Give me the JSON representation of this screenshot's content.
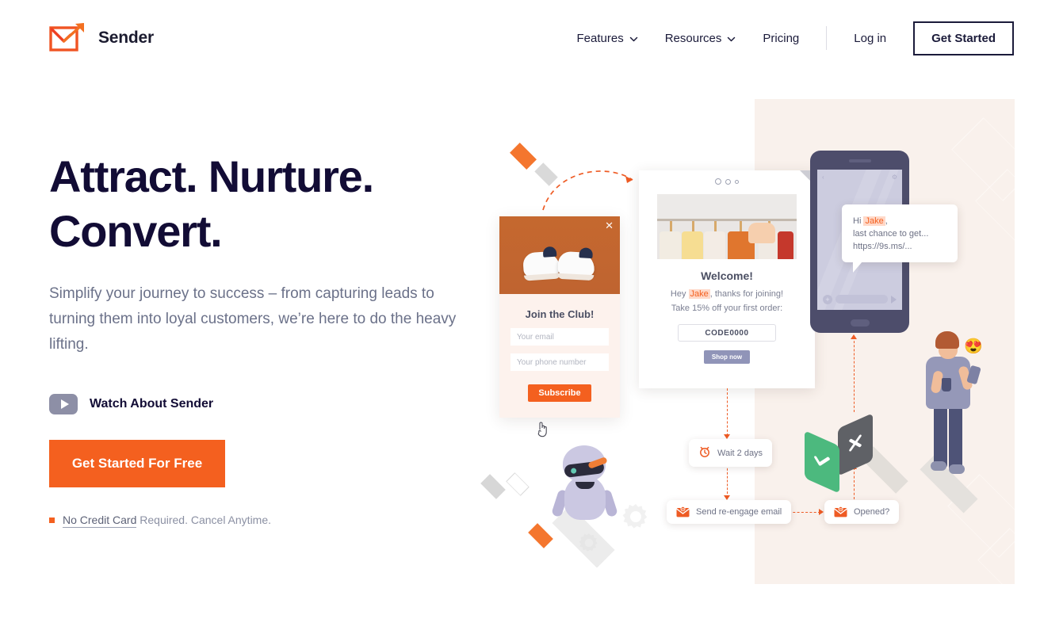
{
  "brand": {
    "name": "Sender",
    "logo_icon": "envelope-arrow-icon",
    "accent": "#f4601f",
    "dark": "#120c35"
  },
  "nav": {
    "items": [
      {
        "label": "Features",
        "has_dropdown": true,
        "icon": "chevron-down-icon"
      },
      {
        "label": "Resources",
        "has_dropdown": true,
        "icon": "chevron-down-icon"
      },
      {
        "label": "Pricing",
        "has_dropdown": false
      }
    ],
    "login_label": "Log in",
    "cta_label": "Get Started"
  },
  "hero": {
    "title_line1": "Attract. Nurture.",
    "title_line2": "Convert.",
    "subtitle": "Simplify your journey to success – from capturing leads to turning them into loyal customers, we’re here to do the heavy lifting.",
    "watch": {
      "label": "Watch About Sender",
      "icon": "play-icon"
    },
    "cta_label": "Get Started For Free",
    "note_strong": "No Credit Card",
    "note_rest": " Required. Cancel Anytime.",
    "note_bullet": "square-bullet-icon"
  },
  "illustration": {
    "popup": {
      "close_icon": "close-icon",
      "title": "Join the Club!",
      "email_placeholder": "Your email",
      "phone_placeholder": "Your phone number",
      "subscribe_label": "Subscribe",
      "image_alt": "sneakers-photo"
    },
    "email": {
      "heading": "Welcome!",
      "line1_pre": "Hey ",
      "line1_name": "Jake",
      "line1_post": ", thanks for joining!",
      "line2": "Take 15% off your first order:",
      "code": "CODE0000",
      "button_label": "Shop now",
      "image_alt": "clothing-rack-photo"
    },
    "sms": {
      "line1_pre": "Hi ",
      "line1_name": "Jake",
      "line1_post": ",",
      "line2": "last chance to get...",
      "line3": "https://9s.ms/..."
    },
    "workflow": [
      {
        "label": "Wait 2 days",
        "icon": "alarm-clock-icon"
      },
      {
        "label": "Send re-engage email",
        "icon": "envelope-icon"
      },
      {
        "label": "Opened?",
        "icon": "envelope-icon"
      }
    ],
    "decision": {
      "yes_icon": "check-icon",
      "no_icon": "x-icon"
    },
    "robot_alt": "automation-robot",
    "person_alt": "person-with-phone",
    "person_emoji": "😍",
    "cursor_icon": "pointer-hand-icon"
  }
}
